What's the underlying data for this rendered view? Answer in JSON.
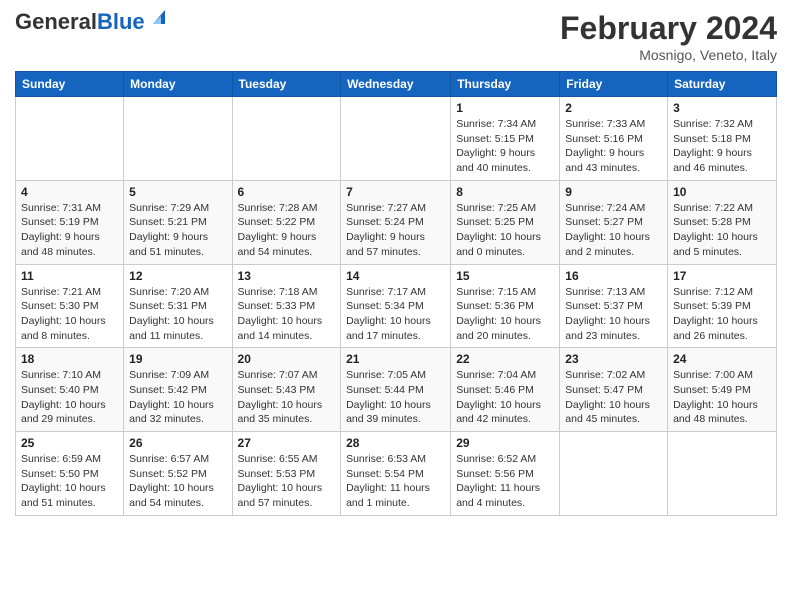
{
  "header": {
    "logo_general": "General",
    "logo_blue": "Blue",
    "month_title": "February 2024",
    "location": "Mosnigo, Veneto, Italy"
  },
  "days_of_week": [
    "Sunday",
    "Monday",
    "Tuesday",
    "Wednesday",
    "Thursday",
    "Friday",
    "Saturday"
  ],
  "weeks": [
    [
      {
        "day": "",
        "info": ""
      },
      {
        "day": "",
        "info": ""
      },
      {
        "day": "",
        "info": ""
      },
      {
        "day": "",
        "info": ""
      },
      {
        "day": "1",
        "info": "Sunrise: 7:34 AM\nSunset: 5:15 PM\nDaylight: 9 hours and 40 minutes."
      },
      {
        "day": "2",
        "info": "Sunrise: 7:33 AM\nSunset: 5:16 PM\nDaylight: 9 hours and 43 minutes."
      },
      {
        "day": "3",
        "info": "Sunrise: 7:32 AM\nSunset: 5:18 PM\nDaylight: 9 hours and 46 minutes."
      }
    ],
    [
      {
        "day": "4",
        "info": "Sunrise: 7:31 AM\nSunset: 5:19 PM\nDaylight: 9 hours and 48 minutes."
      },
      {
        "day": "5",
        "info": "Sunrise: 7:29 AM\nSunset: 5:21 PM\nDaylight: 9 hours and 51 minutes."
      },
      {
        "day": "6",
        "info": "Sunrise: 7:28 AM\nSunset: 5:22 PM\nDaylight: 9 hours and 54 minutes."
      },
      {
        "day": "7",
        "info": "Sunrise: 7:27 AM\nSunset: 5:24 PM\nDaylight: 9 hours and 57 minutes."
      },
      {
        "day": "8",
        "info": "Sunrise: 7:25 AM\nSunset: 5:25 PM\nDaylight: 10 hours and 0 minutes."
      },
      {
        "day": "9",
        "info": "Sunrise: 7:24 AM\nSunset: 5:27 PM\nDaylight: 10 hours and 2 minutes."
      },
      {
        "day": "10",
        "info": "Sunrise: 7:22 AM\nSunset: 5:28 PM\nDaylight: 10 hours and 5 minutes."
      }
    ],
    [
      {
        "day": "11",
        "info": "Sunrise: 7:21 AM\nSunset: 5:30 PM\nDaylight: 10 hours and 8 minutes."
      },
      {
        "day": "12",
        "info": "Sunrise: 7:20 AM\nSunset: 5:31 PM\nDaylight: 10 hours and 11 minutes."
      },
      {
        "day": "13",
        "info": "Sunrise: 7:18 AM\nSunset: 5:33 PM\nDaylight: 10 hours and 14 minutes."
      },
      {
        "day": "14",
        "info": "Sunrise: 7:17 AM\nSunset: 5:34 PM\nDaylight: 10 hours and 17 minutes."
      },
      {
        "day": "15",
        "info": "Sunrise: 7:15 AM\nSunset: 5:36 PM\nDaylight: 10 hours and 20 minutes."
      },
      {
        "day": "16",
        "info": "Sunrise: 7:13 AM\nSunset: 5:37 PM\nDaylight: 10 hours and 23 minutes."
      },
      {
        "day": "17",
        "info": "Sunrise: 7:12 AM\nSunset: 5:39 PM\nDaylight: 10 hours and 26 minutes."
      }
    ],
    [
      {
        "day": "18",
        "info": "Sunrise: 7:10 AM\nSunset: 5:40 PM\nDaylight: 10 hours and 29 minutes."
      },
      {
        "day": "19",
        "info": "Sunrise: 7:09 AM\nSunset: 5:42 PM\nDaylight: 10 hours and 32 minutes."
      },
      {
        "day": "20",
        "info": "Sunrise: 7:07 AM\nSunset: 5:43 PM\nDaylight: 10 hours and 35 minutes."
      },
      {
        "day": "21",
        "info": "Sunrise: 7:05 AM\nSunset: 5:44 PM\nDaylight: 10 hours and 39 minutes."
      },
      {
        "day": "22",
        "info": "Sunrise: 7:04 AM\nSunset: 5:46 PM\nDaylight: 10 hours and 42 minutes."
      },
      {
        "day": "23",
        "info": "Sunrise: 7:02 AM\nSunset: 5:47 PM\nDaylight: 10 hours and 45 minutes."
      },
      {
        "day": "24",
        "info": "Sunrise: 7:00 AM\nSunset: 5:49 PM\nDaylight: 10 hours and 48 minutes."
      }
    ],
    [
      {
        "day": "25",
        "info": "Sunrise: 6:59 AM\nSunset: 5:50 PM\nDaylight: 10 hours and 51 minutes."
      },
      {
        "day": "26",
        "info": "Sunrise: 6:57 AM\nSunset: 5:52 PM\nDaylight: 10 hours and 54 minutes."
      },
      {
        "day": "27",
        "info": "Sunrise: 6:55 AM\nSunset: 5:53 PM\nDaylight: 10 hours and 57 minutes."
      },
      {
        "day": "28",
        "info": "Sunrise: 6:53 AM\nSunset: 5:54 PM\nDaylight: 11 hours and 1 minute."
      },
      {
        "day": "29",
        "info": "Sunrise: 6:52 AM\nSunset: 5:56 PM\nDaylight: 11 hours and 4 minutes."
      },
      {
        "day": "",
        "info": ""
      },
      {
        "day": "",
        "info": ""
      }
    ]
  ]
}
